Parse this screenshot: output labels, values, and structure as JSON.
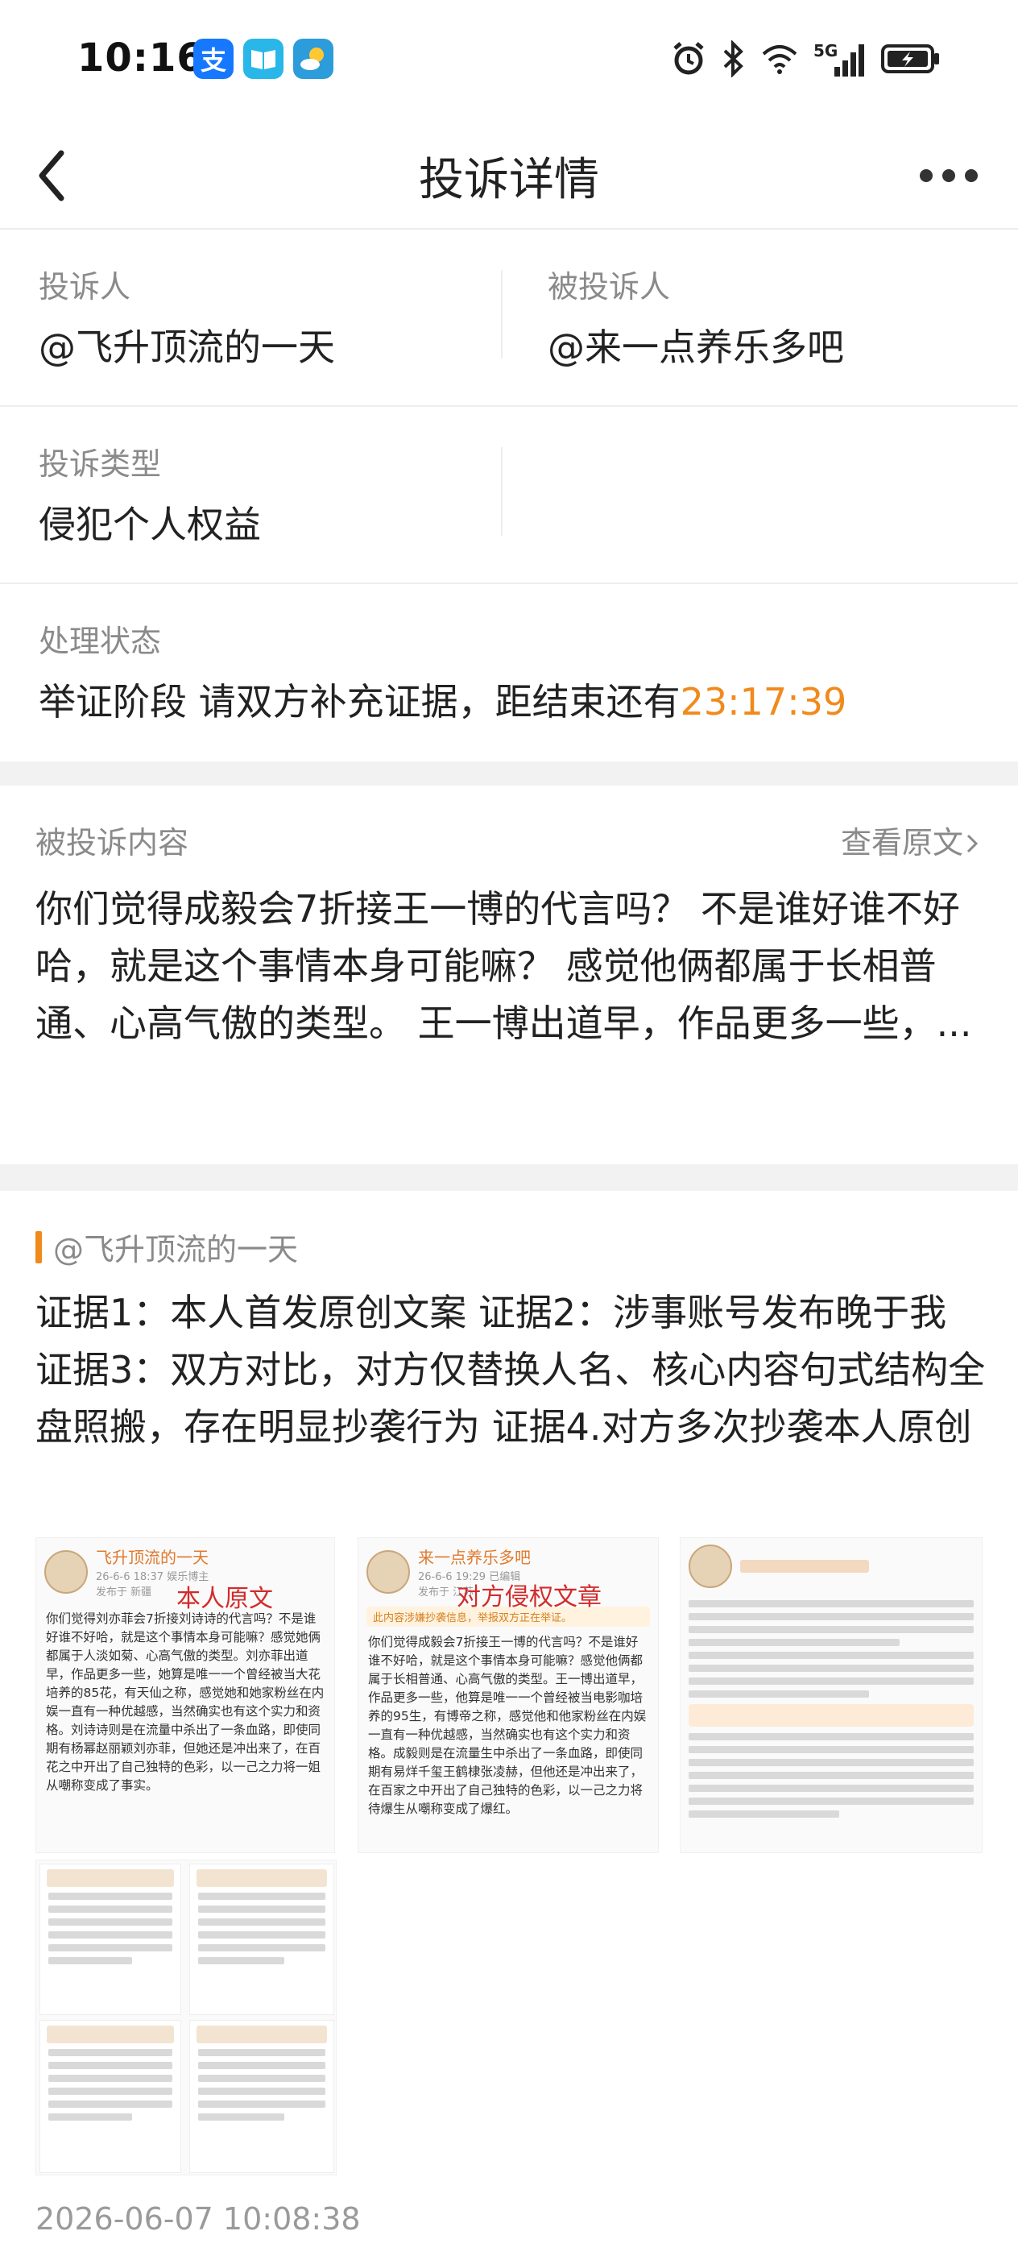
{
  "status_bar": {
    "time": "10:16",
    "app_icons": [
      {
        "name": "alipay-icon",
        "glyph": "支",
        "color": "#1677ff"
      },
      {
        "name": "book-icon",
        "glyph": "📖",
        "color": "#29b6e8"
      },
      {
        "name": "weather-icon",
        "glyph": "",
        "color": "#2d9cdb"
      }
    ],
    "network": "5G"
  },
  "nav": {
    "title": "投诉详情"
  },
  "info": {
    "complainant_label": "投诉人",
    "complainant_value": "@飞升顶流的一天",
    "respondent_label": "被投诉人",
    "respondent_value": "@来一点养乐多吧",
    "type_label": "投诉类型",
    "type_value": "侵犯个人权益",
    "status_label": "处理状态",
    "status_text": "举证阶段 请双方补充证据，距结束还有",
    "countdown": "23:17:39",
    "accent_color": "#f08a1c"
  },
  "content": {
    "label": "被投诉内容",
    "view_original": "查看原文",
    "text": "你们觉得成毅会7折接王一博的代言吗？ 不是谁好谁不好哈，就是这个事情本身可能嘛？ 感觉他俩都属于长相普通、心高气傲的类型。 王一博出道早，作品更多一些，..."
  },
  "evidence": {
    "user": "@飞升顶流的一天",
    "text": "证据1：本人首发原创文案 证据2：涉事账号发布晚于我 证据3：双方对比，对方仅替换人名、核心内容句式结构全盘照搬，存在明显抄袭行为 证据4.对方多次抄袭本人原创",
    "images": {
      "img1": {
        "name": "飞升顶流的一天",
        "meta": "26-6-6 18:37 娱乐博主",
        "meta2": "发布于 新疆",
        "tag": "本人原文",
        "text": "你们觉得刘亦菲会7折接刘诗诗的代言吗？不是谁好谁不好哈，就是这个事情本身可能嘛？感觉她俩都属于人淡如菊、心高气傲的类型。刘亦菲出道早，作品更多一些，她算是唯一一个曾经被当大花培养的85花，有天仙之称，感觉她和她家粉丝在内娱一直有一种优越感，当然确实也有这个实力和资格。刘诗诗则是在流量中杀出了一条血路，即使同期有杨幂赵丽颖刘亦菲，但她还是冲出来了，在百花之中开出了自己独特的色彩，以一己之力将一姐从嘲称变成了事实。"
      },
      "img2": {
        "name": "来一点养乐多吧",
        "meta": "26-6-6 19:29 已编辑",
        "meta2": "发布于 江苏",
        "tag": "对方侵权文章",
        "notice": "此内容涉嫌抄袭信息，举报双方正在举证。",
        "text": "你们觉得成毅会7折接王一博的代言吗？不是谁好谁不好哈，就是这个事情本身可能嘛？感觉他俩都属于长相普通、心高气傲的类型。王一博出道早，作品更多一些，他算是唯一一个曾经被当电影咖培养的95生，有博帝之称，感觉他和他家粉丝在内娱一直有一种优越感，当然确实也有这个实力和资格。成毅则是在流量生中杀出了一条血路，即使同期有易烊千玺王鹤棣张凌赫，但他还是冲出来了，在百家之中开出了自己独特的色彩，以一己之力将待爆生从嘲称变成了爆红。"
      }
    },
    "timestamp": "2026-06-07 10:08:38"
  }
}
